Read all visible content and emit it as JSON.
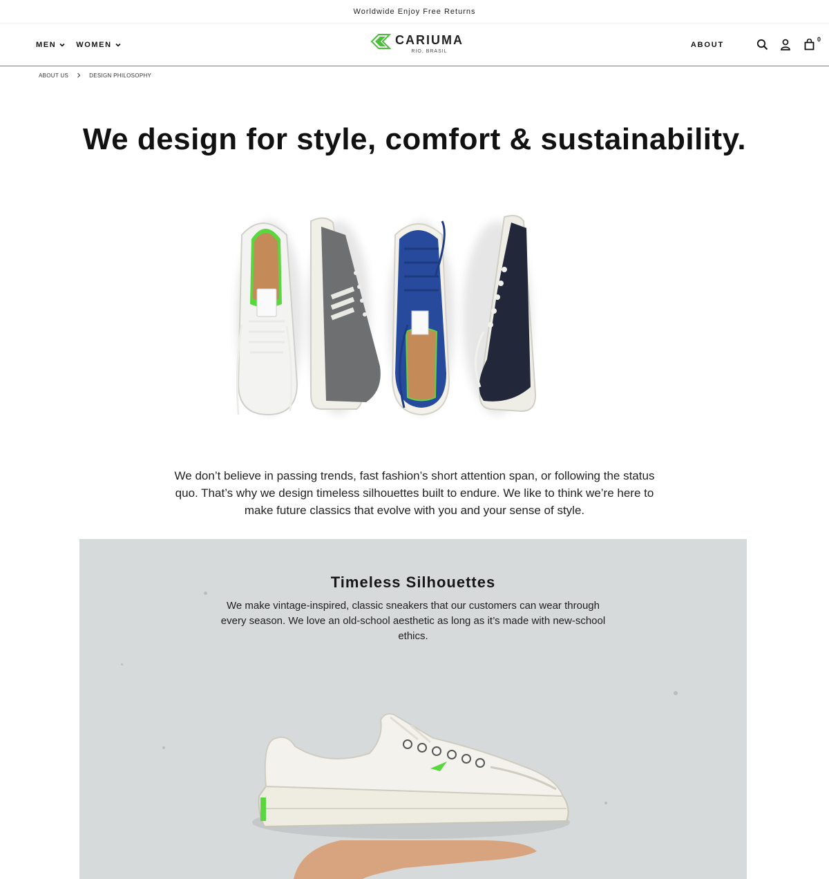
{
  "announcement": "Worldwide Enjoy Free Returns",
  "nav": {
    "men_label": "MEN",
    "women_label": "WOMEN",
    "about_label": "ABOUT",
    "cart_count": "0"
  },
  "logo": {
    "name": "CARIUMA",
    "sub": "RIO, BRASIL",
    "color": "#4bbf3a"
  },
  "breadcrumb": {
    "items": [
      "ABOUT US",
      "DESIGN PHILOSOPHY"
    ]
  },
  "hero": {
    "title": "We design for style, comfort & sustainability."
  },
  "intro": {
    "text": "We don’t believe in passing trends, fast fashion’s short attention span, or following the status quo. That’s why we design timeless silhouettes built to endure. We like to think we’re here to make future classics that evolve with you and your sense of style."
  },
  "feature": {
    "title": "Timeless Silhouettes",
    "text": "We make vintage-inspired, classic sneakers that our customers can wear through every season. We love an old-school aesthetic as long as it’s made with new-school ethics."
  },
  "icons": {
    "search": "search-icon",
    "account": "user-icon",
    "cart": "bag-icon"
  }
}
